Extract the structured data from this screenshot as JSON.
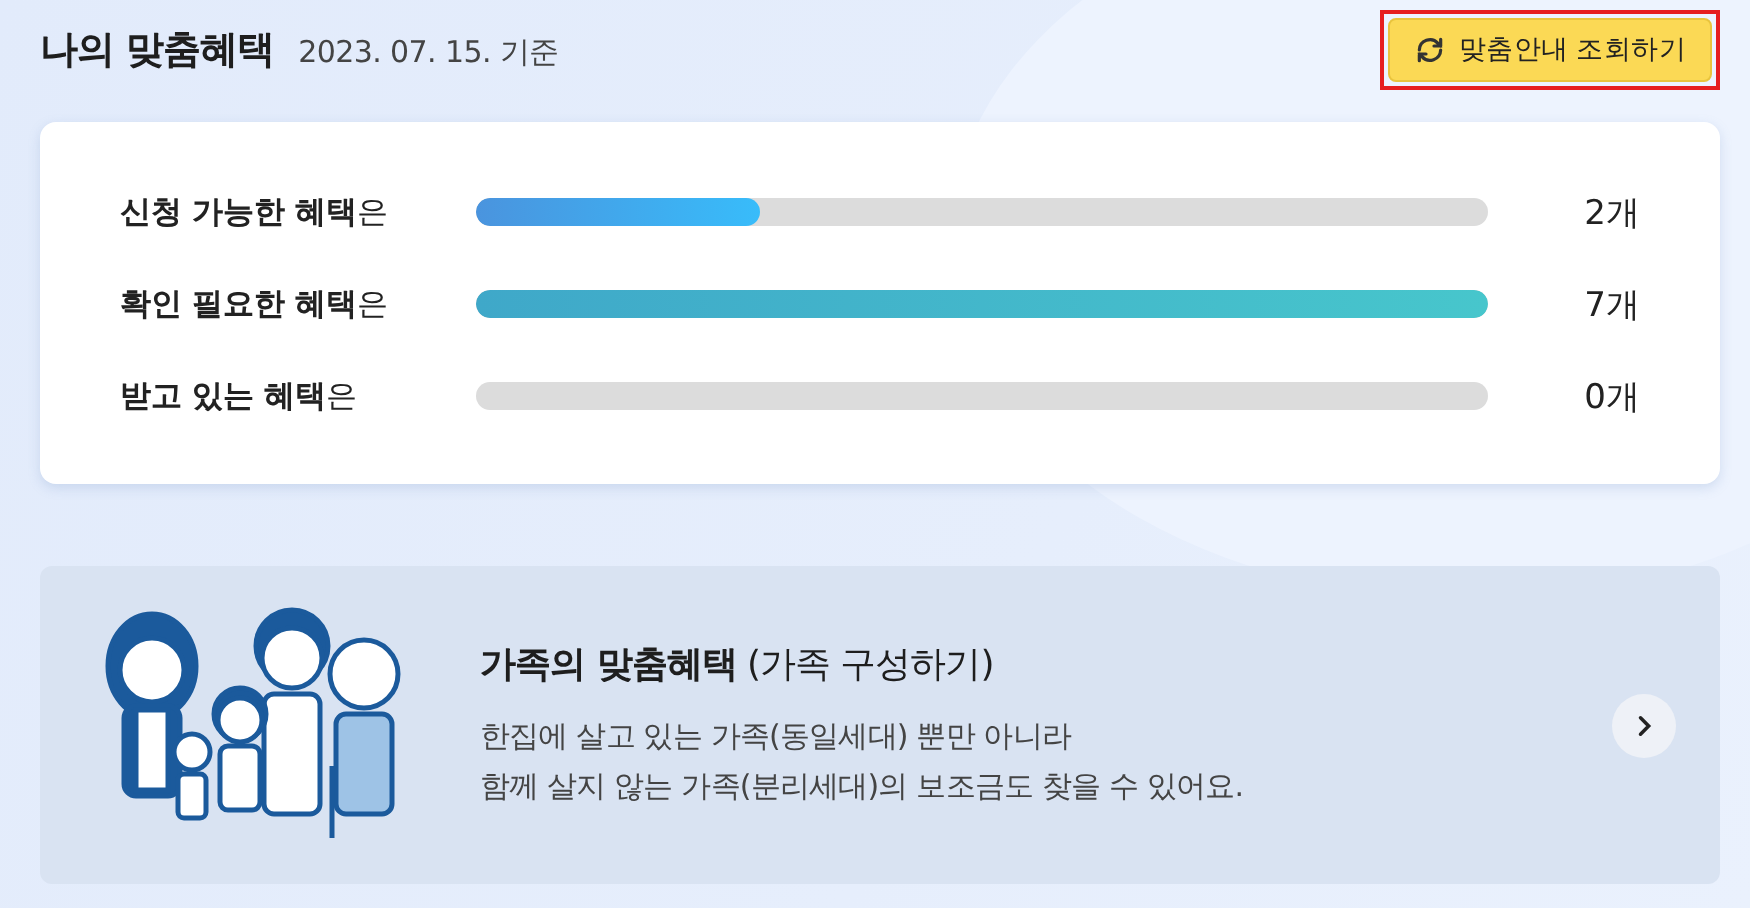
{
  "header": {
    "title": "나의 맞춤혜택",
    "date": "2023. 07. 15. 기준",
    "button": {
      "label": "맞춤안내 조회하기",
      "highlighted": true
    }
  },
  "benefits": [
    {
      "label": "**신청 가능한 혜택**은",
      "level": 0.28,
      "count": "2개",
      "kind": "blue"
    },
    {
      "label": "**확인 필요한 혜택**은",
      "level": 1,
      "count": "7개",
      "kind": "teal"
    },
    {
      "label": "**받고 있는 혜택**은",
      "level": 0,
      "count": "0개",
      "kind": "blue"
    }
  ],
  "family": {
    "title": "**가족의 맞춤혜택** (가족 구성하기)",
    "lines": [
      "한집에 살고 있는 가족(동일세대) 뿐만 아니라",
      "함께 살지 않는 가족(분리세대)의 보조금도 찾을 수 있어요."
    ]
  }
}
